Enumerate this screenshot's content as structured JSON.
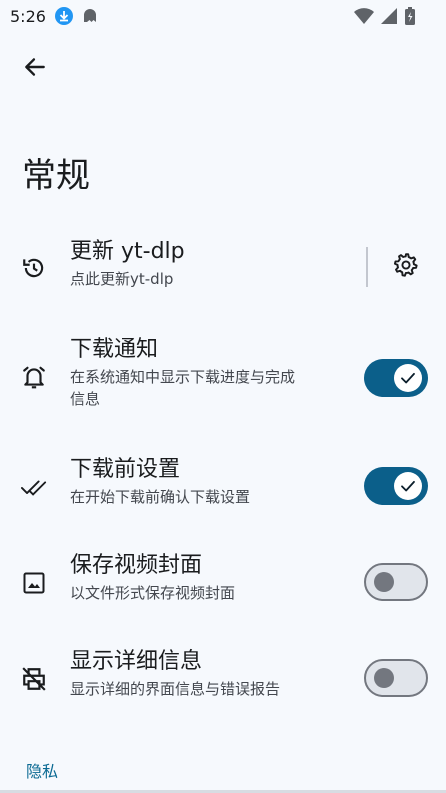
{
  "status_bar": {
    "time": "5:26",
    "icons": [
      "download-icon",
      "notification-ghost-icon",
      "wifi-icon",
      "signal-icon",
      "battery-icon"
    ]
  },
  "header": {
    "back_icon": "arrow-back-icon",
    "title": "常规"
  },
  "settings": [
    {
      "id": "update",
      "icon": "update-history-icon",
      "title": "更新 yt-dlp",
      "subtitle": "点此更新yt-dlp",
      "trailing": "gear-icon"
    },
    {
      "id": "download-notification",
      "icon": "bell-icon",
      "title": "下载通知",
      "subtitle_line1": "在系统通知中显示下载进度与完成",
      "subtitle_line2": "信息",
      "enabled": true
    },
    {
      "id": "pre-download-settings",
      "icon": "double-check-icon",
      "title": "下载前设置",
      "subtitle": "在开始下载前确认下载设置",
      "enabled": true
    },
    {
      "id": "save-thumbnail",
      "icon": "image-icon",
      "title": "保存视频封面",
      "subtitle": "以文件形式保存视频封面",
      "enabled": false
    },
    {
      "id": "show-details",
      "icon": "print-disabled-icon",
      "title": "显示详细信息",
      "subtitle": "显示详细的界面信息与错误报告",
      "enabled": false
    }
  ],
  "section": {
    "label": "隐私"
  },
  "colors": {
    "background": "#f6f9fd",
    "accent": "#0b5f8a",
    "section_label": "#0b6a93"
  }
}
